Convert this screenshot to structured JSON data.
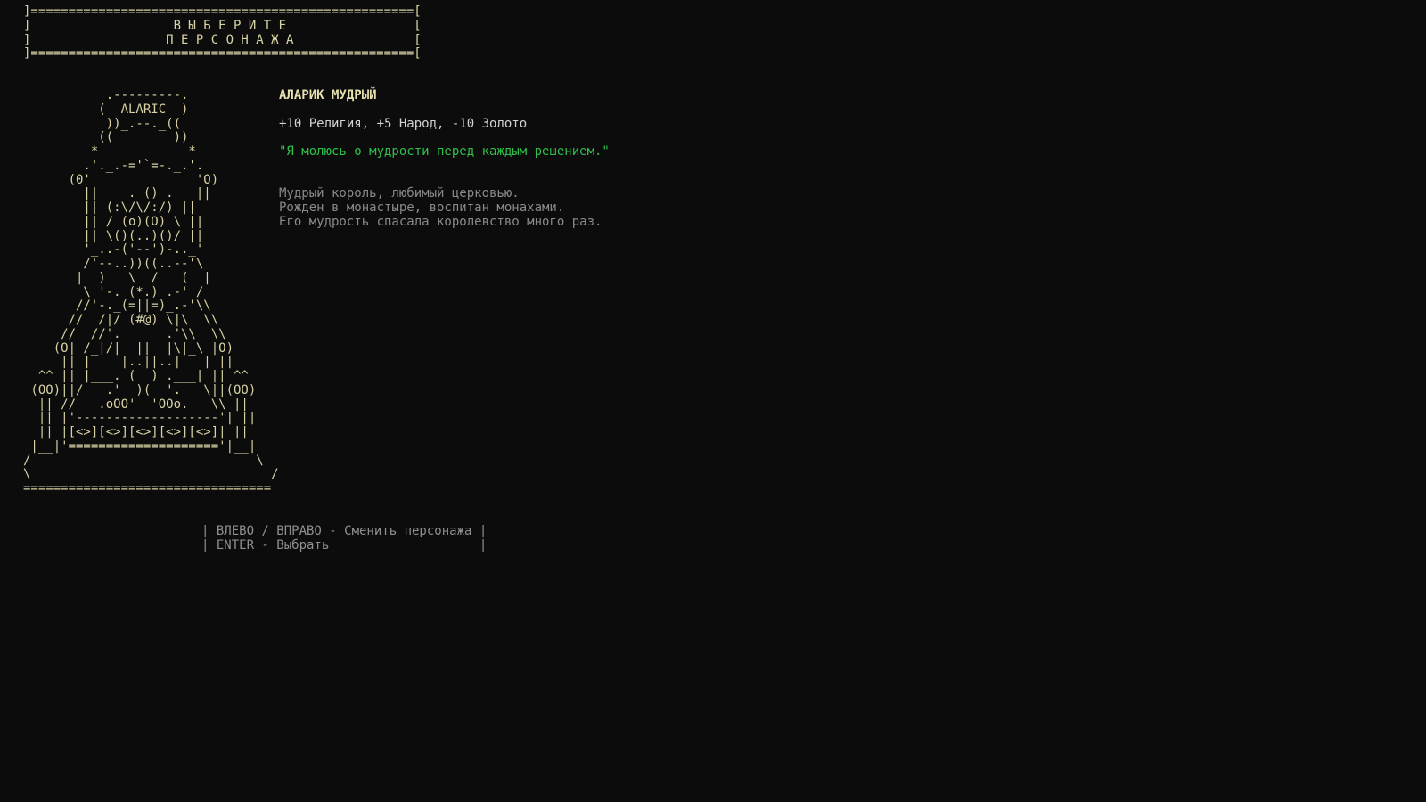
{
  "banner": {
    "border_top": "]===================================================[",
    "line1": "]                   В Ы Б Е Р И Т Е                 [",
    "line2": "]                  П Е Р С О Н А Ж А                [",
    "border_bottom": "]===================================================["
  },
  "character": {
    "ascii_art": "           .---------.\n          (  ALARIC  )\n           ))_.--._((\n          ((        ))\n         *            *\n        .'._.-='`=-._.'.\n      (0'              'O)\n        ||    . () .   ||\n        || (:\\/\\/:/) ||\n        || / (o)(O) \\ ||\n        || \\()(..)()/ ||\n        '_..-('--')-.._'\n        /'--..))((..--'\\\n       |  )   \\  /   (  |\n        \\ '-._(*.)_.-' /\n       //'-._(=||=)_.-'\\\\\n      //  /|/ (#@) \\|\\  \\\\\n     //  //'.      .'\\\\  \\\\\n    (O| /_|/|  ||  |\\|_\\ |O)\n     || |    |..||..|   | ||\n  ^^ || |___. (  ) .___| || ^^\n (OO)||/   .'  )(  '.   \\||(OO)\n  || //   .oOO'  'OOo.   \\\\ ||\n  || |'-------------------'| ||\n  || |[<>][<>][<>][<>][<>]| ||\n |__|'===================='|__|\n/                              \\\n\\                                /\n=================================",
    "name": "АЛАРИК МУДРЫЙ",
    "stats": "+10 Религия, +5 Народ, -10 Золото",
    "quote": "\"Я молюсь о мудрости перед каждым решением.\"",
    "description": [
      "Мудрый король, любимый церковью.",
      "Рожден в монастыре, воспитан монахами.",
      "Его мудрость спасала королевство много раз."
    ]
  },
  "controls": {
    "row1": "| ВЛЕВО / ВПРАВО - Сменить персонажа |",
    "row2": "| ENTER - Выбрать                    |"
  },
  "colors": {
    "background": "#0c0c0c",
    "art": "#d8d2a4",
    "name": "#e6dfae",
    "stats": "#d3d3d3",
    "quote": "#2fbf4a",
    "description": "#8a8a8a",
    "controls": "#8f8f8f"
  }
}
